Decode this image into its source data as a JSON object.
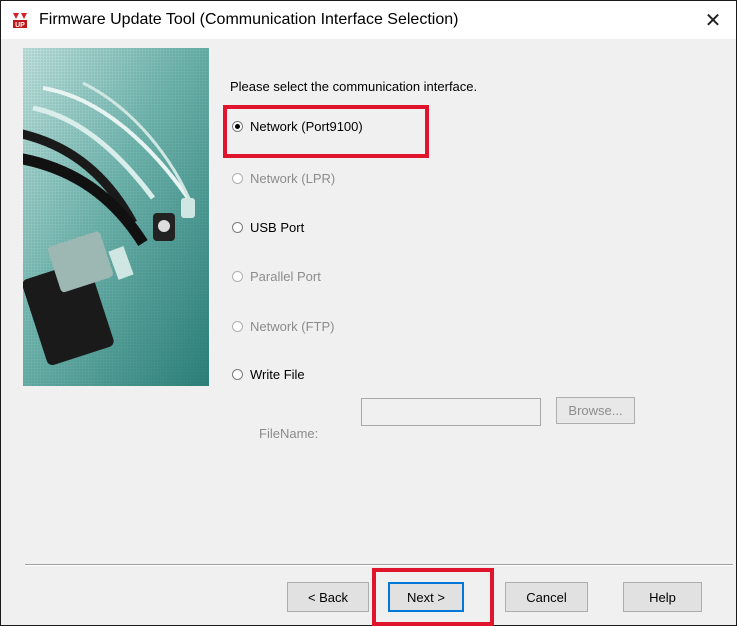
{
  "window": {
    "title": "Firmware Update Tool (Communication Interface Selection)",
    "close_glyph": "✕",
    "icon": "firmware-update-icon"
  },
  "prompt": "Please select the communication interface.",
  "interfaces": [
    {
      "label": "Network (Port9100)",
      "selected": true,
      "enabled": true
    },
    {
      "label": "Network (LPR)",
      "selected": false,
      "enabled": false
    },
    {
      "label": "USB Port",
      "selected": false,
      "enabled": true
    },
    {
      "label": "Parallel Port",
      "selected": false,
      "enabled": false
    },
    {
      "label": "Network (FTP)",
      "selected": false,
      "enabled": false
    },
    {
      "label": "Write File",
      "selected": false,
      "enabled": true
    }
  ],
  "file": {
    "label": "FileName:",
    "value": "",
    "browse_label": "Browse..."
  },
  "buttons": {
    "back": "< Back",
    "next": "Next >",
    "cancel": "Cancel",
    "help": "Help"
  },
  "colors": {
    "highlight": "#e0142d",
    "image_teal": "#2f8c86"
  }
}
